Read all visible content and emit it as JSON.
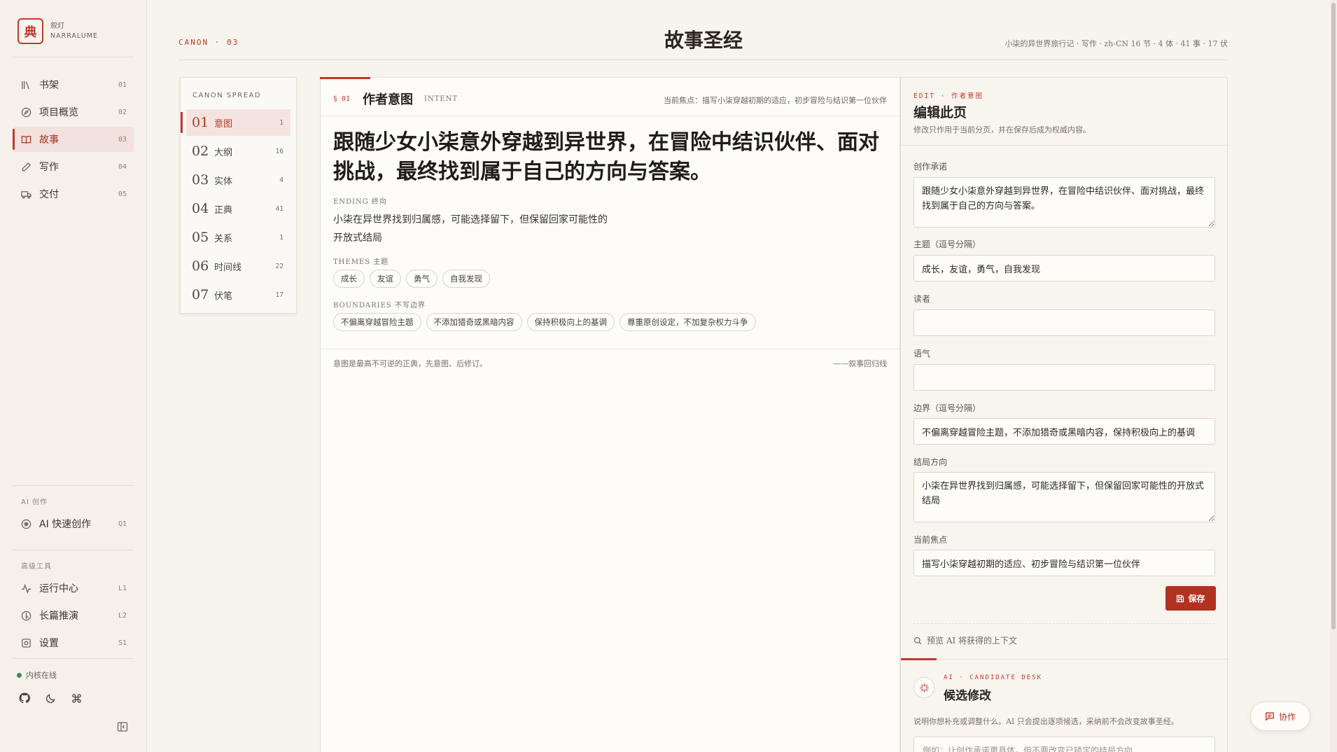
{
  "brand": {
    "logo_char": "典",
    "name_cn": "叙灯",
    "name_en": "NARRALUME"
  },
  "sidebar": {
    "nav": [
      {
        "label": "书架",
        "code": "01",
        "icon": "books-icon"
      },
      {
        "label": "项目概览",
        "code": "02",
        "icon": "compass-icon"
      },
      {
        "label": "故事",
        "code": "03",
        "icon": "book-open-icon",
        "active": true
      },
      {
        "label": "写作",
        "code": "04",
        "icon": "pen-icon"
      },
      {
        "label": "交付",
        "code": "05",
        "icon": "truck-icon"
      }
    ],
    "ai_section": "AI 创作",
    "ai_items": [
      {
        "label": "AI 快速创作",
        "code": "Q1",
        "icon": "sparkle-icon"
      }
    ],
    "tools_section": "高级工具",
    "tools_items": [
      {
        "label": "运行中心",
        "code": "L1",
        "icon": "activity-icon"
      },
      {
        "label": "长篇推演",
        "code": "L2",
        "icon": "compass-alt-icon"
      },
      {
        "label": "设置",
        "code": "S1",
        "icon": "settings-icon"
      }
    ],
    "status": "内核在线"
  },
  "header": {
    "section": "CANON · 03",
    "title": "故事圣经",
    "meta": "小柒的异世界旅行记 · 写作 · zh-CN   16 节 · 4 体 · 41 事 · 17 伏"
  },
  "spread": {
    "title": "CANON SPREAD",
    "items": [
      {
        "num": "01",
        "label": "意图",
        "count": "1",
        "active": true
      },
      {
        "num": "02",
        "label": "大纲",
        "count": "16"
      },
      {
        "num": "03",
        "label": "实体",
        "count": "4"
      },
      {
        "num": "04",
        "label": "正典",
        "count": "41"
      },
      {
        "num": "05",
        "label": "关系",
        "count": "1"
      },
      {
        "num": "06",
        "label": "时间线",
        "count": "22"
      },
      {
        "num": "07",
        "label": "伏笔",
        "count": "17"
      }
    ]
  },
  "main": {
    "section_num": "§ 01",
    "section_title": "作者意图",
    "section_sub": "INTENT",
    "focus": "当前焦点：描写小柒穿越初期的适应，初步冒险与结识第一位伙伴",
    "promise": "跟随少女小柒意外穿越到异世界，在冒险中结识伙伴、面对挑战，最终找到属于自己的方向与答案。",
    "ending_label": "ENDING 终向",
    "ending_text": "小柒在异世界找到归属感，可能选择留下，但保留回家可能性的开放式结局",
    "themes_label": "THEMES 主题",
    "themes": [
      "成长",
      "友谊",
      "勇气",
      "自我发现"
    ],
    "boundaries_label": "BOUNDARIES 不写边界",
    "boundaries": [
      "不偏离穿越冒险主题",
      "不添加猎奇或黑暗内容",
      "保持积极向上的基调",
      "尊重原创设定，不加复杂权力斗争"
    ],
    "footnote": "意图是最高不可逆的正典，先意图、后修订。",
    "signature": "——叙事回归线"
  },
  "edit": {
    "tag": "EDIT · 作者意图",
    "title": "编辑此页",
    "desc": "修改只作用于当前分页，并在保存后成为权威内容。",
    "promise_label": "创作承诺",
    "promise_value": "跟随少女小柒意外穿越到异世界，在冒险中结识伙伴、面对挑战，最终找到属于自己的方向与答案。",
    "themes_label": "主题（逗号分隔）",
    "themes_value": "成长，友谊，勇气，自我发现",
    "reader_label": "读者",
    "reader_value": "",
    "tone_label": "语气",
    "tone_value": "",
    "bounds_label": "边界（逗号分隔）",
    "bounds_value": "不偏离穿越冒险主题，不添加猎奇或黑暗内容，保持积极向上的基调",
    "ending_label": "结局方向",
    "ending_value": "小柒在异世界找到归属感，可能选择留下，但保留回家可能性的开放式结局",
    "focus_label": "当前焦点",
    "focus_value": "描写小柒穿越初期的适应、初步冒险与结识第一位伙伴",
    "save_label": "保存",
    "preview_label": "预览 AI 将获得的上下文"
  },
  "ai_desk": {
    "tag": "AI · CANDIDATE DESK",
    "title": "候选修改",
    "desc": "说明你想补充或调整什么。AI 只会提出逐项候选，采纳前不会改变故事圣经。",
    "placeholder": "例如：让创作承诺更具体，但不要改变已锁定的结局方向"
  },
  "collab_label": "协作",
  "accent_color": "#c0392b"
}
